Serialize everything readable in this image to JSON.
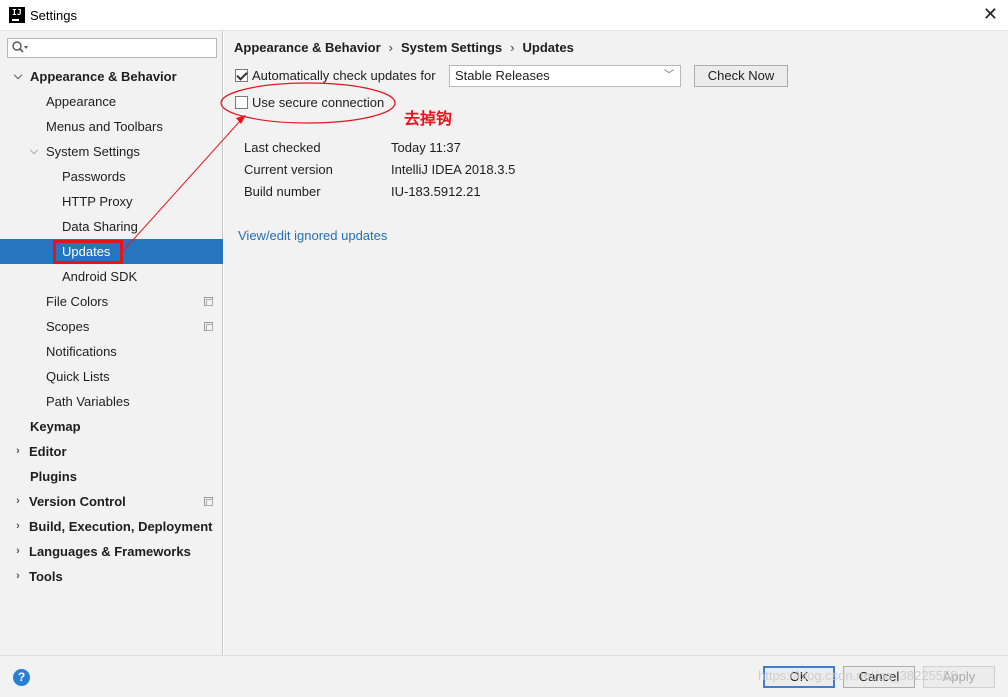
{
  "window": {
    "title": "Settings",
    "close_icon": "close-icon"
  },
  "sidebar": {
    "search": {
      "value": "",
      "placeholder": ""
    },
    "items": [
      {
        "label": "Appearance & Behavior",
        "level": 0,
        "expanded": true,
        "bold": true
      },
      {
        "label": "Appearance",
        "level": 1
      },
      {
        "label": "Menus and Toolbars",
        "level": 1
      },
      {
        "label": "System Settings",
        "level": 1,
        "expanded": true
      },
      {
        "label": "Passwords",
        "level": 2
      },
      {
        "label": "HTTP Proxy",
        "level": 2
      },
      {
        "label": "Data Sharing",
        "level": 2
      },
      {
        "label": "Updates",
        "level": 2,
        "selected": true
      },
      {
        "label": "Android SDK",
        "level": 2
      },
      {
        "label": "File Colors",
        "level": 1,
        "project_icon": true
      },
      {
        "label": "Scopes",
        "level": 1,
        "project_icon": true
      },
      {
        "label": "Notifications",
        "level": 1
      },
      {
        "label": "Quick Lists",
        "level": 1
      },
      {
        "label": "Path Variables",
        "level": 1
      },
      {
        "label": "Keymap",
        "level": 0,
        "bold": true
      },
      {
        "label": "Editor",
        "level": 0,
        "bold": true,
        "collapsed": true
      },
      {
        "label": "Plugins",
        "level": 0,
        "bold": true
      },
      {
        "label": "Version Control",
        "level": 0,
        "bold": true,
        "collapsed": true,
        "project_icon": true
      },
      {
        "label": "Build, Execution, Deployment",
        "level": 0,
        "bold": true,
        "collapsed": true
      },
      {
        "label": "Languages & Frameworks",
        "level": 0,
        "bold": true,
        "collapsed": true
      },
      {
        "label": "Tools",
        "level": 0,
        "bold": true,
        "collapsed": true
      }
    ]
  },
  "main": {
    "breadcrumb": [
      "Appearance & Behavior",
      "System Settings",
      "Updates"
    ],
    "auto_check": {
      "label": "Automatically check updates for",
      "checked": true
    },
    "channel_select": {
      "value": "Stable Releases"
    },
    "check_now_label": "Check Now",
    "secure_connection": {
      "label": "Use secure connection",
      "checked": false
    },
    "info": [
      {
        "label": "Last checked",
        "value": "Today 11:37"
      },
      {
        "label": "Current version",
        "value": "IntelliJ IDEA 2018.3.5"
      },
      {
        "label": "Build number",
        "value": "IU-183.5912.21"
      }
    ],
    "ignored_link": "View/edit ignored updates"
  },
  "annotation": {
    "text": "去掉钩",
    "color": "#e8141c"
  },
  "footer": {
    "help_icon": "help-icon",
    "ok_label": "OK",
    "cancel_label": "Cancel",
    "apply_label": "Apply"
  },
  "watermark": "https://blog.csdn.net/qq_38225558",
  "colors": {
    "selection": "#2675bf",
    "link": "#2470b3",
    "annotation": "#e8141c",
    "background": "#f2f2f2"
  }
}
